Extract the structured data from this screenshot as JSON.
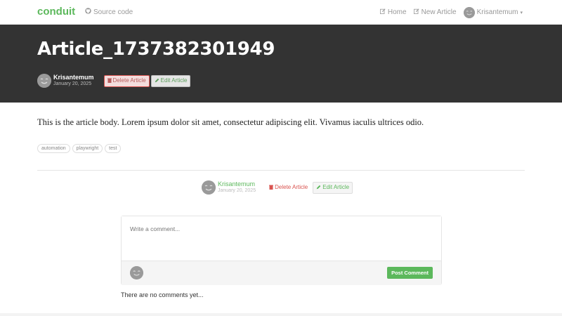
{
  "nav": {
    "brand": "conduit",
    "source_link": "Source code",
    "home": "Home",
    "new_article": "New Article",
    "user": "Krisantemum"
  },
  "article": {
    "title": "Article_1737382301949",
    "author": "Krisantemum",
    "date": "January 20, 2025",
    "body": "This is the article body. Lorem ipsum dolor sit amet, consectetur adipiscing elit. Vivamus iaculis ultrices odio.",
    "tags": [
      "automation",
      "playwright",
      "test"
    ],
    "delete_label": "Delete Article",
    "edit_label": "Edit Article"
  },
  "comment_form": {
    "placeholder": "Write a comment...",
    "post_label": "Post Comment"
  },
  "comments_empty": "There are no comments yet...",
  "colors": {
    "brand": "#5cb85c",
    "banner": "#333333",
    "danger": "#b85c5c"
  },
  "icons": {
    "source": "github-icon",
    "home": "edit-icon",
    "new_article": "edit-icon",
    "delete": "trash-icon",
    "edit": "pencil-icon",
    "user_menu": "caret-down-icon"
  }
}
